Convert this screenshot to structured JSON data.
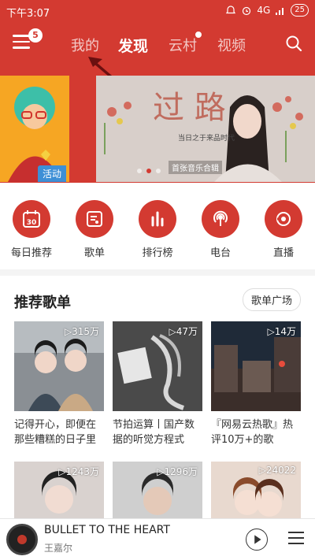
{
  "status_bar": {
    "time": "下午3:07",
    "network": "4G",
    "battery": "25"
  },
  "top_nav": {
    "badge_count": "5",
    "tabs": [
      {
        "label": "我的"
      },
      {
        "label": "发现"
      },
      {
        "label": "云村"
      },
      {
        "label": "视频"
      }
    ],
    "active_tab": "发现"
  },
  "banner": {
    "tag": "活动",
    "title_chars": "过 路",
    "subtitle": "当日之于来品时代",
    "caption": "首张音乐合辑",
    "slide_count": 3,
    "active_slide": 1
  },
  "shortcuts": [
    {
      "label": "每日推荐",
      "icon": "calendar-30-icon",
      "day": "30"
    },
    {
      "label": "歌单",
      "icon": "playlist-icon"
    },
    {
      "label": "排行榜",
      "icon": "chart-bars-icon"
    },
    {
      "label": "电台",
      "icon": "radio-icon"
    },
    {
      "label": "直播",
      "icon": "live-icon"
    }
  ],
  "recommended": {
    "title": "推荐歌单",
    "more_label": "歌单广场",
    "playlists": [
      {
        "plays": "▷315万",
        "caption": "记得开心，即便在那些糟糕的日子里"
      },
      {
        "plays": "▷47万",
        "caption": "节拍运算丨国产数据的听觉方程式"
      },
      {
        "plays": "▷14万",
        "caption": "『网易云热歌』热评10万+的歌"
      },
      {
        "plays": "▷1243万",
        "caption": ""
      },
      {
        "plays": "▷1296万",
        "caption": ""
      },
      {
        "plays": "▷24022",
        "caption": ""
      }
    ]
  },
  "player": {
    "song": "BULLET TO THE HEART",
    "artist": "王嘉尔"
  },
  "colors": {
    "brand_red": "#d33a31",
    "tag_blue": "#3d8fd6"
  }
}
